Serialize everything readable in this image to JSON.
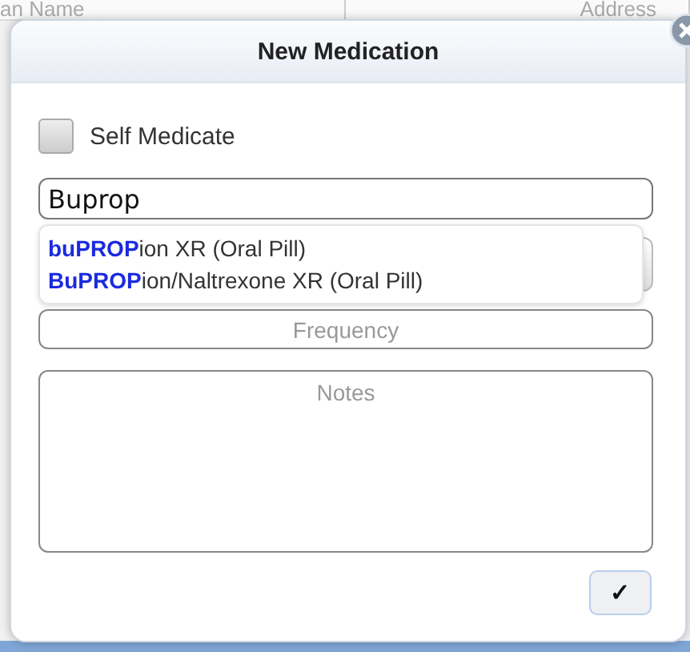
{
  "background": {
    "columns": [
      "an Name",
      "Address"
    ]
  },
  "dialog": {
    "title": "New Medication",
    "self_medicate": {
      "label": "Self Medicate",
      "checked": false
    },
    "search": {
      "value": "Buprop"
    },
    "suggestions": [
      {
        "text": "**buPROP**ion XR (Oral Pill)"
      },
      {
        "text": "**BuPROP**ion/Naltrexone XR (Oral Pill)"
      }
    ],
    "frequency": {
      "placeholder": "Frequency"
    },
    "notes": {
      "placeholder": "Notes"
    },
    "confirm_button": {
      "label": "✓"
    }
  }
}
